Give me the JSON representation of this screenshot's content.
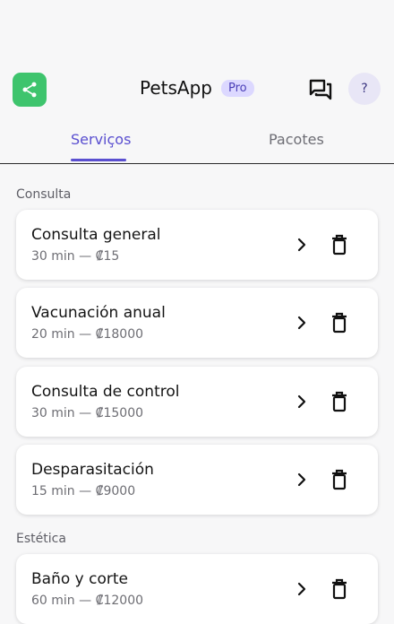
{
  "header": {
    "share_icon": "share-icon",
    "title": "PetsApp",
    "badge": "Pro",
    "chat_icon": "chat-icon",
    "help_label": "?"
  },
  "tabs": [
    {
      "label": "Serviços",
      "active": true
    },
    {
      "label": "Pacotes",
      "active": false
    }
  ],
  "sections": [
    {
      "label": "Consulta",
      "items": [
        {
          "name": "Consulta general",
          "meta": "30 min — ₡15"
        },
        {
          "name": "Vacunación anual",
          "meta": "20 min — ₡18000"
        },
        {
          "name": "Consulta de control",
          "meta": "30 min — ₡15000"
        },
        {
          "name": "Desparasitación",
          "meta": "15 min — ₡9000"
        }
      ]
    },
    {
      "label": "Estética",
      "items": [
        {
          "name": "Baño y corte",
          "meta": "60 min — ₡12000"
        }
      ]
    }
  ],
  "colors": {
    "accent": "#5a4fd0",
    "share": "#3ec46d",
    "badge_bg": "#dcd8ff"
  }
}
